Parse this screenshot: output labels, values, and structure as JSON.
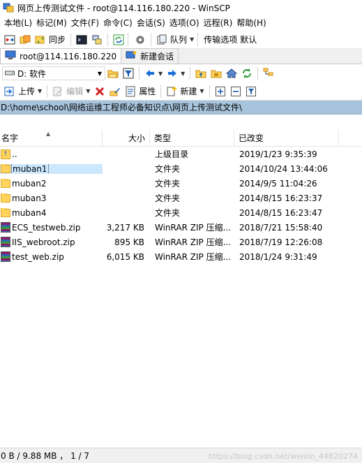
{
  "window": {
    "title": "网页上传测试文件 - root@114.116.180.220 - WinSCP"
  },
  "menu": [
    "本地(L)",
    "标记(M)",
    "文件(F)",
    "命令(C)",
    "会话(S)",
    "选项(O)",
    "远程(R)",
    "帮助(H)"
  ],
  "toolbar": {
    "sync_label": "同步",
    "queue_label": "队列",
    "transfer_options_label": "传输选项",
    "transfer_options_value": "默认"
  },
  "tabs": {
    "session_label": "root@114.116.180.220",
    "new_session_label": "新建会话"
  },
  "drive": {
    "label": "D: 软件"
  },
  "actions": {
    "upload_label": "上传",
    "edit_label": "编辑",
    "properties_label": "属性",
    "new_label": "新建"
  },
  "current_path": "D:\\home\\school\\网络运维工程师必备知识点\\网页上传测试文件\\",
  "columns": {
    "name": "名字",
    "size": "大小",
    "type": "类型",
    "modified": "已改变"
  },
  "files": [
    {
      "name": "..",
      "size": "",
      "type": "上级目录",
      "modified": "2019/1/23   9:35:39",
      "icon": "parent-dir-icon",
      "kind": "up"
    },
    {
      "name": "muban1",
      "size": "",
      "type": "文件夹",
      "modified": "2014/10/24  13:44:06",
      "icon": "folder-icon",
      "kind": "folder"
    },
    {
      "name": "muban2",
      "size": "",
      "type": "文件夹",
      "modified": "2014/9/5  11:04:26",
      "icon": "folder-icon",
      "kind": "folder"
    },
    {
      "name": "muban3",
      "size": "",
      "type": "文件夹",
      "modified": "2014/8/15  16:23:37",
      "icon": "folder-icon",
      "kind": "folder"
    },
    {
      "name": "muban4",
      "size": "",
      "type": "文件夹",
      "modified": "2014/8/15  16:23:47",
      "icon": "folder-icon",
      "kind": "folder"
    },
    {
      "name": "ECS_testweb.zip",
      "size": "3,217 KB",
      "type": "WinRAR ZIP 压缩...",
      "modified": "2018/7/21  15:58:40",
      "icon": "winrar-zip-icon",
      "kind": "zip"
    },
    {
      "name": "IIS_webroot.zip",
      "size": "895 KB",
      "type": "WinRAR ZIP 压缩...",
      "modified": "2018/7/19  12:26:08",
      "icon": "winrar-zip-icon",
      "kind": "zip"
    },
    {
      "name": "test_web.zip",
      "size": "6,015 KB",
      "type": "WinRAR ZIP 压缩...",
      "modified": "2018/1/24   9:31:49",
      "icon": "winrar-zip-icon",
      "kind": "zip"
    }
  ],
  "selected_index": 1,
  "status": {
    "text": "0 B / 9.88 MB ，  1 / 7",
    "watermark": "https://blog.csdn.net/weixin_44820274"
  }
}
